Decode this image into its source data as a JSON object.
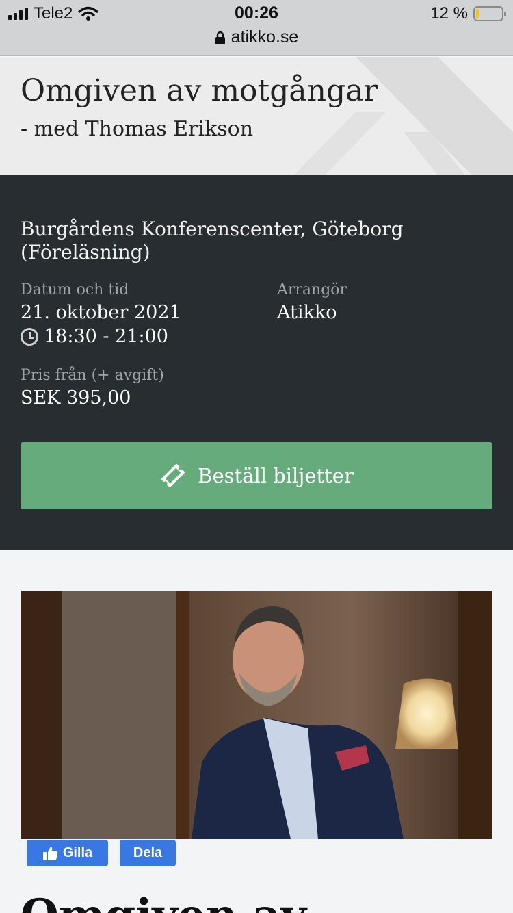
{
  "status_bar": {
    "carrier": "Tele2",
    "time": "00:26",
    "battery_percent": "12 %",
    "battery_level": 0.12,
    "url": "atikko.se"
  },
  "event": {
    "title": "Omgiven av motgångar",
    "subtitle": "- med Thomas Erikson",
    "venue": "Burgårdens Konferenscenter, Göteborg (Föreläsning)",
    "date_label": "Datum och tid",
    "date": "21. oktober 2021",
    "time": "18:30 - 21:00",
    "organizer_label": "Arrangör",
    "organizer": "Atikko",
    "price_label": "Pris från (+ avgift)",
    "price": "SEK 395,00",
    "cta_label": "Beställ biljetter"
  },
  "social": {
    "like_label": "Gilla",
    "share_label": "Dela"
  },
  "content": {
    "heading": "Omgiven av"
  },
  "colors": {
    "panel": "#272d30",
    "cta": "#66ab7b",
    "facebook": "#3978e3"
  }
}
